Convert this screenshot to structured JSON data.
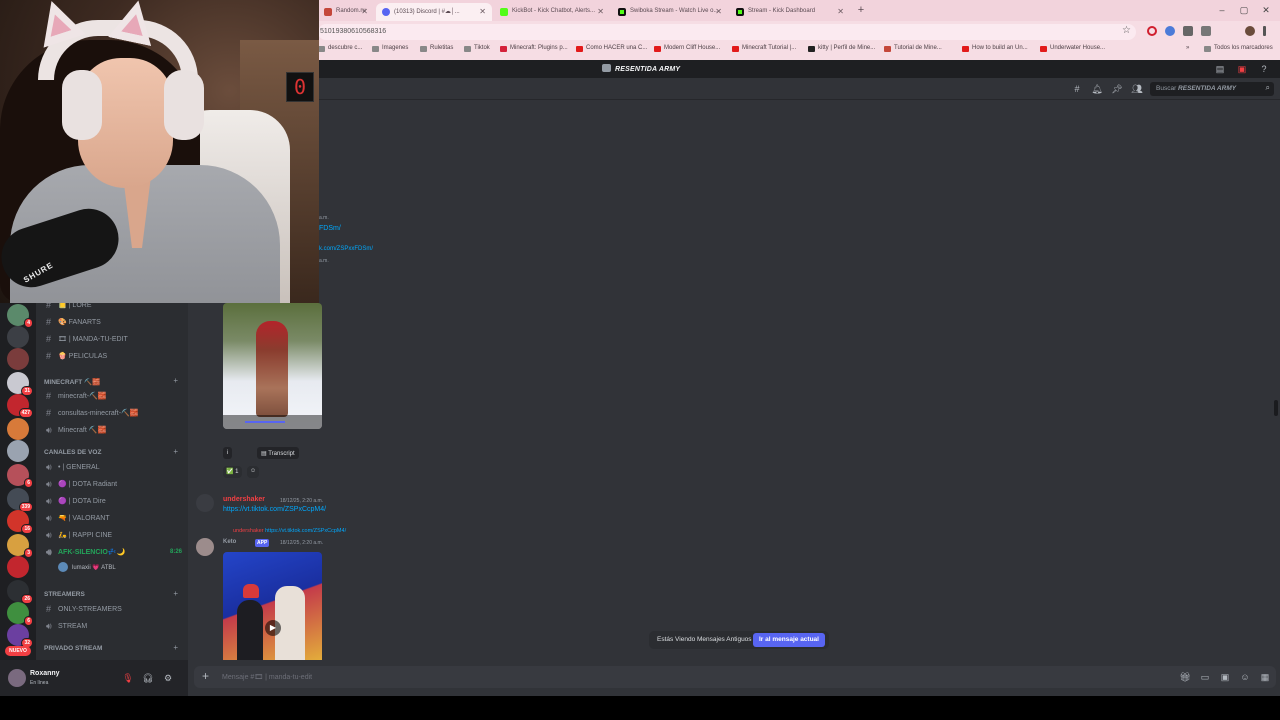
{
  "browser": {
    "tabs": [
      {
        "label": "Random.ru",
        "color": "#c4473a",
        "active": false
      },
      {
        "label": "(10313) Discord | #☁│...",
        "color": "#5865f2",
        "active": true
      },
      {
        "label": "KickBot - Kick Chatbot, Alerts...",
        "color": "#53fc18",
        "active": false
      },
      {
        "label": "Swiboka Stream - Watch Live o...",
        "color": "#1a1a1a",
        "active": false
      },
      {
        "label": "Stream - Kick Dashboard",
        "color": "#1a1a1a",
        "active": false
      }
    ],
    "url": "51019380610568316",
    "bookmarks": [
      {
        "label": "descubre c...",
        "color": "#888888"
      },
      {
        "label": "Imagenes",
        "color": "#888888"
      },
      {
        "label": "Ruletitas",
        "color": "#888888"
      },
      {
        "label": "Tiktok",
        "color": "#888888"
      },
      {
        "label": "Minecraft: Plugins p...",
        "color": "#d4213a"
      },
      {
        "label": "Como HACER una C...",
        "color": "#e21a1a"
      },
      {
        "label": "Modern Cliff House...",
        "color": "#e21a1a"
      },
      {
        "label": "Minecraft Tutorial |...",
        "color": "#e21a1a"
      },
      {
        "label": "kitty | Perfil de Mine...",
        "color": "#222222"
      },
      {
        "label": "Tutorial de Mine...",
        "color": "#c4473a"
      },
      {
        "label": "How to build an Un...",
        "color": "#e21a1a"
      },
      {
        "label": "Underwater House...",
        "color": "#e21a1a"
      }
    ],
    "all_bookmarks": "Todos los marcadores"
  },
  "discord": {
    "server_title": "RESENTIDA ARMY",
    "search": {
      "prefix": "Buscar ",
      "server": "RESENTIDA ARMY"
    },
    "guild_badges": [
      "4",
      "31",
      "427",
      "6",
      "339",
      "16",
      "3",
      "26",
      "6",
      "32",
      "26"
    ],
    "nuevo": "NUEVO",
    "channels": {
      "top": [
        {
          "glyph": "#",
          "label": "📒 | LORE"
        },
        {
          "glyph": "#",
          "label": "🎨 FANARTS"
        },
        {
          "glyph": "#",
          "label": "🎞 | MANDA-TU-EDIT"
        },
        {
          "glyph": "#",
          "label": "🍿 PELICULAS"
        }
      ],
      "minecraft_cat": "MINECRAFT ⛏️🧱",
      "minecraft": [
        {
          "glyph": "#",
          "label": "minecraft-⛏️🧱"
        },
        {
          "glyph": "#",
          "label": "consultas-minecraft-⛏️🧱"
        },
        {
          "glyph": "🔊",
          "label": "Minecraft ⛏️🧱"
        }
      ],
      "voice_cat": "CANALES DE VOZ",
      "voice": [
        {
          "glyph": "🔊",
          "label": "• | GENERAL"
        },
        {
          "glyph": "🔊",
          "label": "🟣 | DOTA Radiant"
        },
        {
          "glyph": "🔊",
          "label": "🟣 | DOTA Dire"
        },
        {
          "glyph": "🔊",
          "label": "🔫 | VALORANT"
        },
        {
          "glyph": "🔊",
          "label": "🛵 | RAPPI CINE"
        },
        {
          "glyph": "🔊",
          "label": "AFK-SILENCIO💤🌙",
          "timer": "8:26"
        }
      ],
      "voice_user": "lumaxii 💗 ATBL",
      "streamers_cat": "STREAMERS",
      "streamers": [
        {
          "glyph": "#",
          "label": "ONLY-STREAMERS"
        },
        {
          "glyph": "🔊",
          "label": "STREAM"
        }
      ],
      "private_cat": "PRIVADO STREAM"
    },
    "user": {
      "name": "Roxanny",
      "status": "En línea"
    },
    "messages": {
      "frag_1": "a.m.",
      "frag_2": "FDSm/",
      "frag_3": "k.com/ZSPxxFDSm/",
      "frag_4": "a.m.",
      "transcript_label": "Transcript",
      "info_label": "i",
      "reaction_count": "1",
      "msg1": {
        "author": "undershaker",
        "time": "18/12/25, 2:20 a.m.",
        "link": "https://vt.tiktok.com/ZSPxCcpM4/"
      },
      "msg2": {
        "reply_author": "undershaker",
        "reply_link": "https://vt.tiktok.com/ZSPxCcpM4/",
        "author": "Keto",
        "app": "APP",
        "time": "18/12/25, 2:20 a.m."
      }
    },
    "old_messages": {
      "text": "Estás Viendo Mensajes Antiguos",
      "button": "Ir al mensaje actual"
    },
    "composer_placeholder": "Mensaje #🎞 | manda-tu-edit"
  },
  "webcam": {
    "mic_brand": "SHURE",
    "clock": "0"
  }
}
